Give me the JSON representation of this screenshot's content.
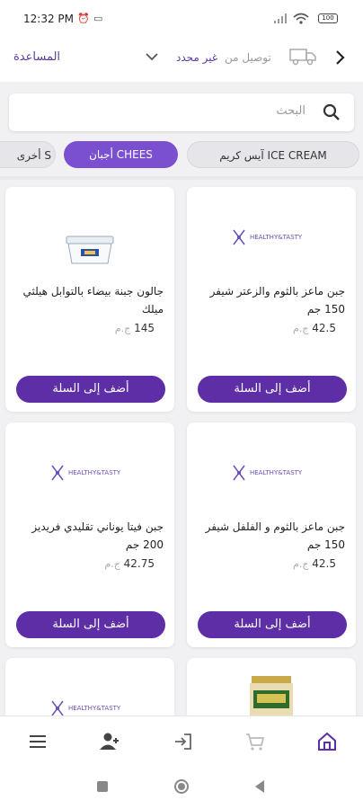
{
  "status_bar": {
    "time": "12:32 PM",
    "battery": "100"
  },
  "header": {
    "help": "المساعدة",
    "delivery_label": "توصيل من",
    "delivery_value": "غير محدد",
    "icons": [
      "back-chevron-icon",
      "truck-icon",
      "chevron-down-icon"
    ]
  },
  "search": {
    "placeholder": "البحث"
  },
  "categories": [
    {
      "label": "آيس كريم ICE CREAM",
      "active": false
    },
    {
      "label": "أجبان CHEES",
      "active": true
    },
    {
      "label": "أخرى S",
      "active": false
    }
  ],
  "products": [
    {
      "name": "جبن ماعز بالثوم والزعتر شيفر 150 جم",
      "price": "42.5",
      "currency": "ج.م",
      "button": "أضف إلى السلة",
      "image": "healthy-tasty-logo"
    },
    {
      "name": "جالون جبنة بيضاء بالتوابل هيلثي ميلك",
      "price": "145",
      "currency": "ج.م",
      "button": "أضف إلى السلة",
      "image": "cheese-tub"
    },
    {
      "name": "جبن ماعز بالثوم و الفلفل شيفر 150 جم",
      "price": "42.5",
      "currency": "ج.م",
      "button": "أضف إلى السلة",
      "image": "healthy-tasty-logo"
    },
    {
      "name": "جبن فيتا يوناني تقليدي فريديز 200 جم",
      "price": "42.75",
      "currency": "ج.م",
      "button": "أضف إلى السلة",
      "image": "healthy-tasty-logo"
    }
  ],
  "logo_text": "HEALTHY&TASTY",
  "bottom_nav": [
    "home-icon",
    "cart-icon",
    "login-icon",
    "account-icon",
    "menu-icon"
  ],
  "colors": {
    "brand": "#5d2ea6",
    "chip_active": "#7a4fd0"
  }
}
